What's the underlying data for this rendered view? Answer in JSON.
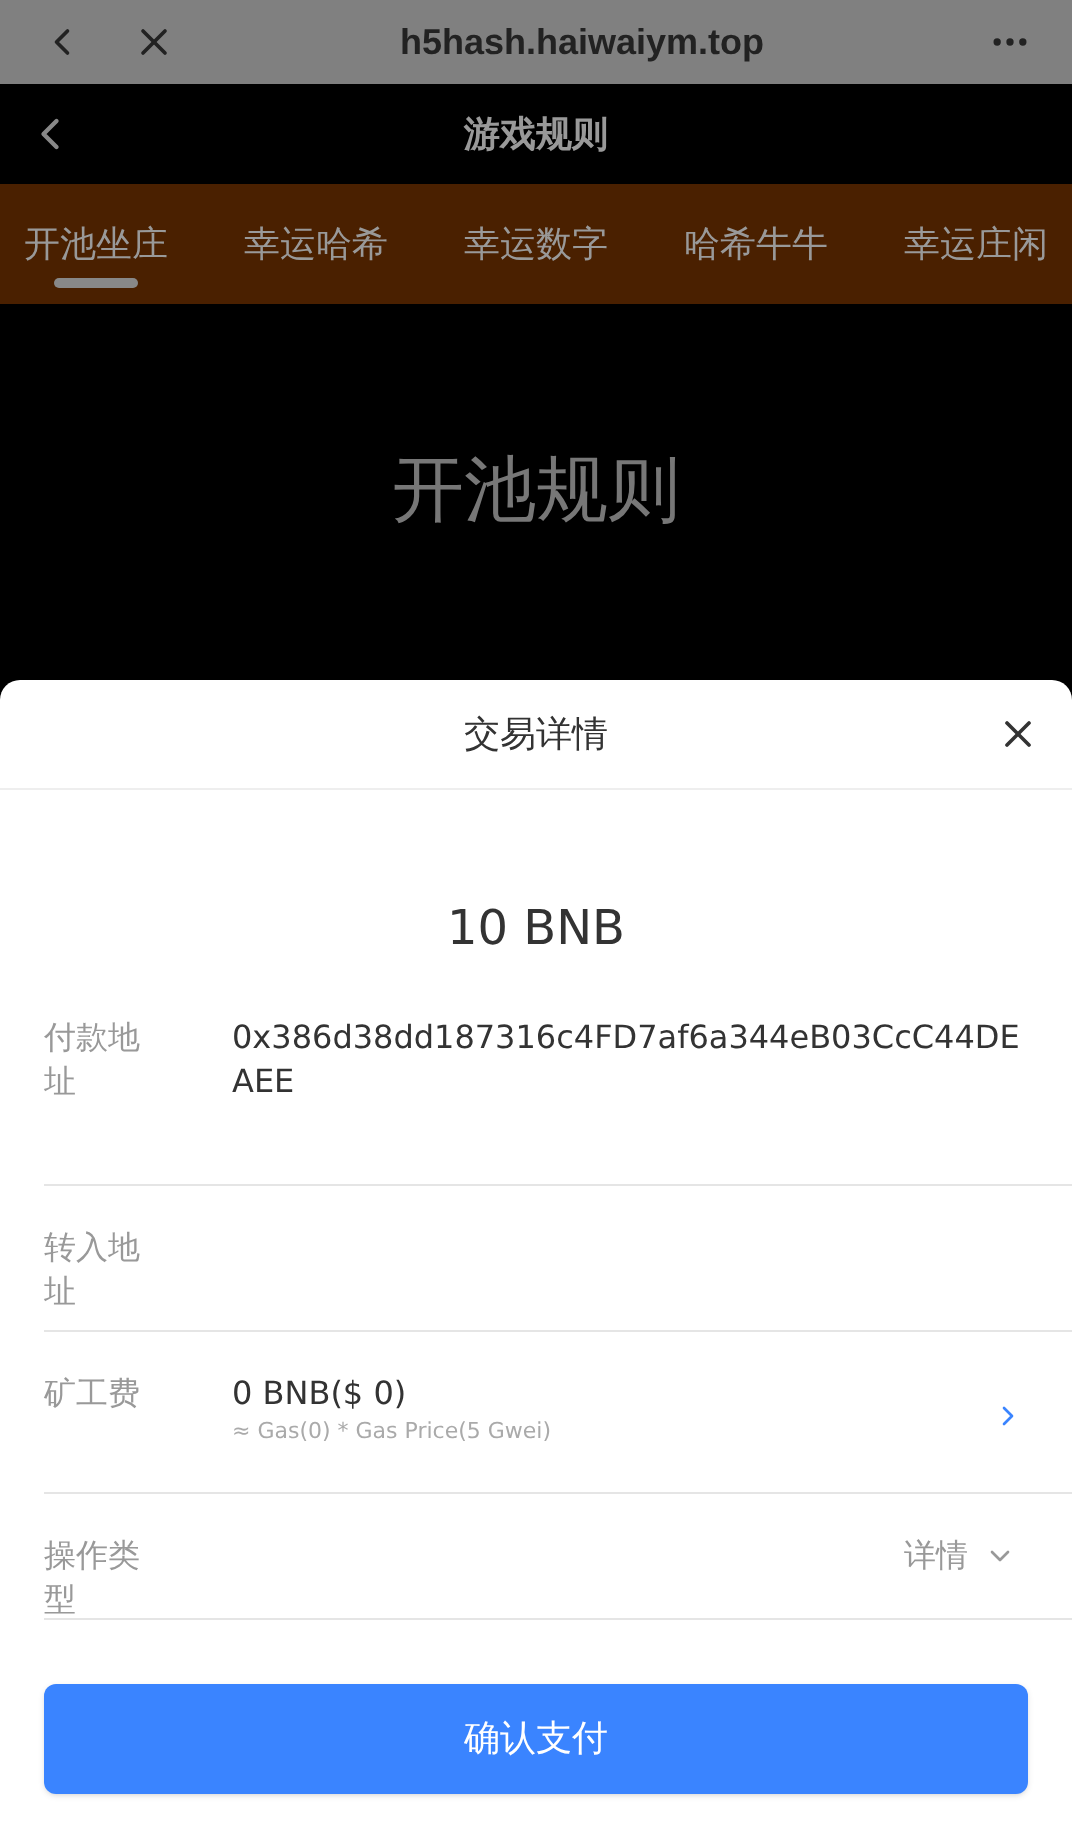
{
  "browser_bar": {
    "url": "h5hash.haiwaiym.top"
  },
  "header": {
    "title": "游戏规则"
  },
  "tabs": [
    {
      "label": "开池坐庄",
      "selected": true
    },
    {
      "label": "幸运哈希",
      "selected": false
    },
    {
      "label": "幸运数字",
      "selected": false
    },
    {
      "label": "哈希牛牛",
      "selected": false
    },
    {
      "label": "幸运庄闲",
      "selected": false
    }
  ],
  "page_heading": "开池规则",
  "sheet": {
    "title": "交易详情",
    "amount": "10 BNB",
    "rows": [
      {
        "kind": "value",
        "label": "付款地址",
        "value": "0x386d38dd187316c4FD7af6a344eB03CcC44DEAEE"
      },
      {
        "kind": "value",
        "label": "转入地址"
      },
      {
        "kind": "fee",
        "label": "矿工费",
        "value": "0 BNB($ 0)",
        "sub": "≈ Gas(0) * Gas Price(5 Gwei)"
      },
      {
        "kind": "detail",
        "label": "操作类型",
        "link": "详情"
      }
    ],
    "confirm": "确认支付"
  }
}
